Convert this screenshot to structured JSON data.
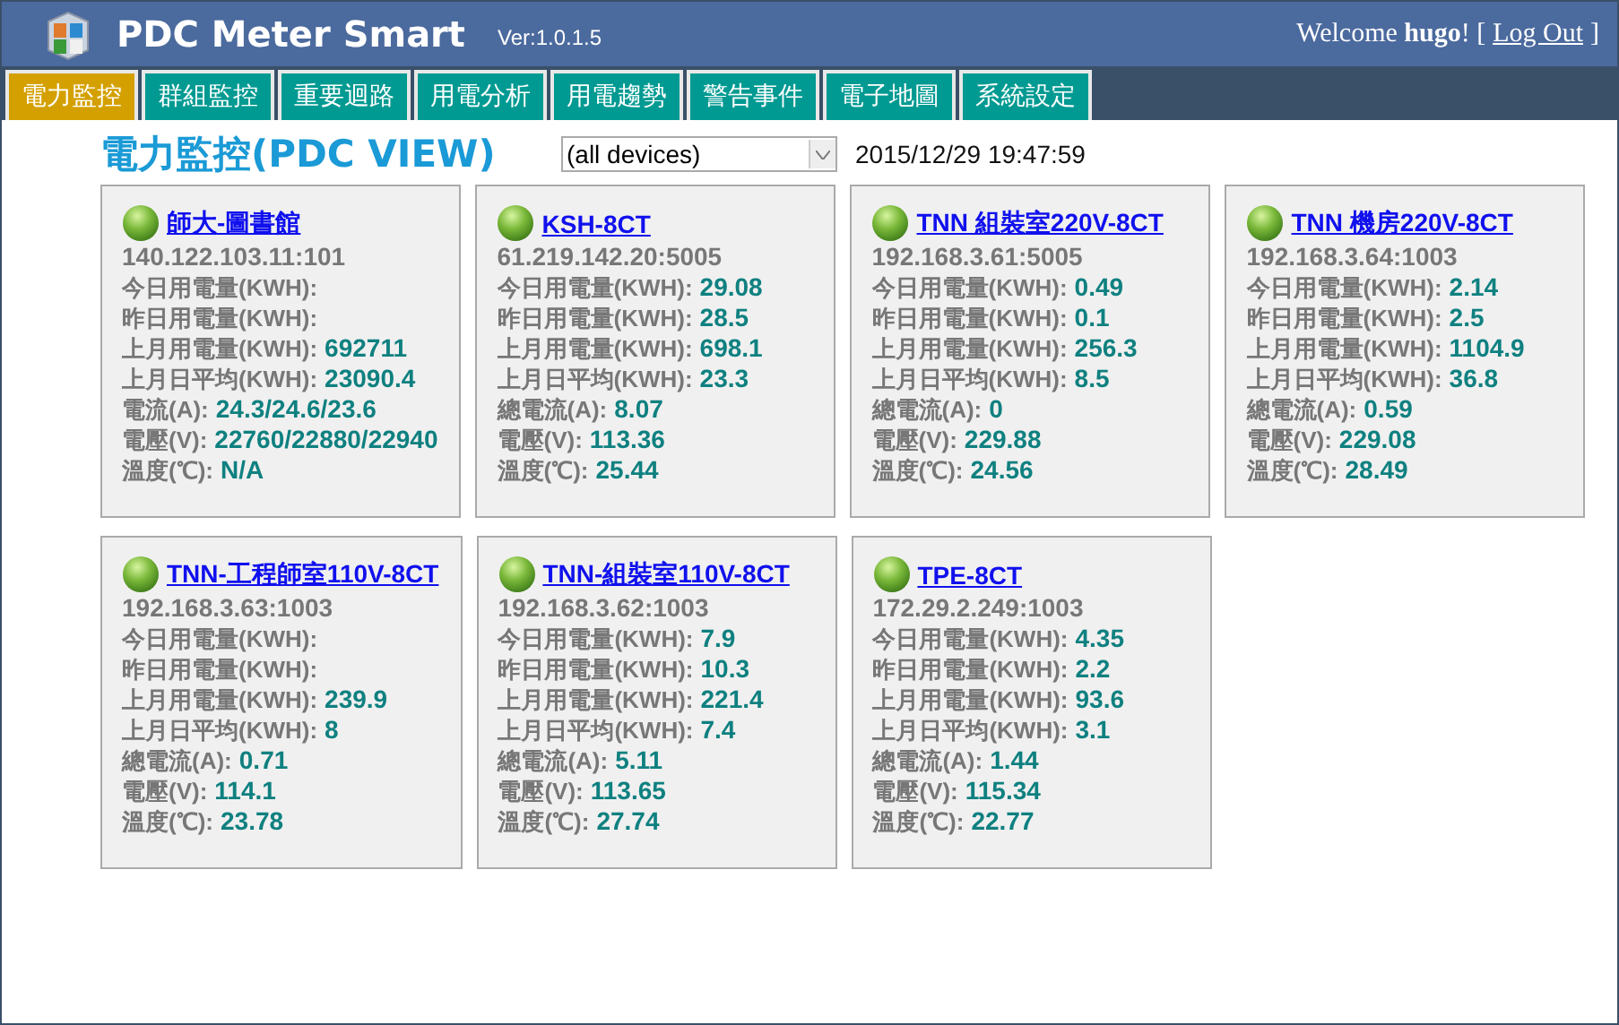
{
  "app": {
    "title": "PDC Meter Smart",
    "version": "Ver:1.0.1.5",
    "welcome": "Welcome",
    "user": "hugo",
    "welcome_end": "! [",
    "logout": "Log Out",
    "bracket_close": "]"
  },
  "tabs": [
    {
      "label": "電力監控",
      "selected": true
    },
    {
      "label": "群組監控",
      "selected": false
    },
    {
      "label": "重要迴路",
      "selected": false
    },
    {
      "label": "用電分析",
      "selected": false
    },
    {
      "label": "用電趨勢",
      "selected": false
    },
    {
      "label": "警告事件",
      "selected": false
    },
    {
      "label": "電子地圖",
      "selected": false
    },
    {
      "label": "系統設定",
      "selected": false
    }
  ],
  "page": {
    "title": "電力監控(PDC VIEW)",
    "device_filter": "(all devices)",
    "timestamp": "2015/12/29 19:47:59"
  },
  "devices": [
    {
      "name": "師大-圖書館",
      "address": "140.122.103.11:101",
      "rows": [
        {
          "label": "今日用電量(KWH):"
        },
        {
          "label": "昨日用電量(KWH):"
        },
        {
          "label": "上月用電量(KWH):",
          "value": "692711"
        },
        {
          "label": "上月日平均(KWH):",
          "value": "23090.4"
        },
        {
          "label": "電流(A):",
          "value": "24.3/24.6/23.6"
        },
        {
          "label": "電壓(V):",
          "value": "22760/22880/22940"
        },
        {
          "label": "溫度(℃):",
          "value": "N/A"
        }
      ]
    },
    {
      "name": "KSH-8CT",
      "address": "61.219.142.20:5005",
      "rows": [
        {
          "label": "今日用電量(KWH):",
          "value": "29.08"
        },
        {
          "label": "昨日用電量(KWH):",
          "value": "28.5"
        },
        {
          "label": "上月用電量(KWH):",
          "value": "698.1"
        },
        {
          "label": "上月日平均(KWH):",
          "value": "23.3"
        },
        {
          "label": "總電流(A):",
          "value": "8.07"
        },
        {
          "label": "電壓(V):",
          "value": "113.36"
        },
        {
          "label": "溫度(℃):",
          "value": "25.44"
        }
      ]
    },
    {
      "name": "TNN 組裝室220V-8CT",
      "address": "192.168.3.61:5005",
      "rows": [
        {
          "label": "今日用電量(KWH):",
          "value": "0.49"
        },
        {
          "label": "昨日用電量(KWH):",
          "value": "0.1"
        },
        {
          "label": "上月用電量(KWH):",
          "value": "256.3"
        },
        {
          "label": "上月日平均(KWH):",
          "value": "8.5"
        },
        {
          "label": "總電流(A):",
          "value": "0"
        },
        {
          "label": "電壓(V):",
          "value": "229.88"
        },
        {
          "label": "溫度(℃):",
          "value": "24.56"
        }
      ]
    },
    {
      "name": "TNN 機房220V-8CT",
      "address": "192.168.3.64:1003",
      "rows": [
        {
          "label": "今日用電量(KWH):",
          "value": "2.14"
        },
        {
          "label": "昨日用電量(KWH):",
          "value": "2.5"
        },
        {
          "label": "上月用電量(KWH):",
          "value": "1104.9"
        },
        {
          "label": "上月日平均(KWH):",
          "value": "36.8"
        },
        {
          "label": "總電流(A):",
          "value": "0.59"
        },
        {
          "label": "電壓(V):",
          "value": "229.08"
        },
        {
          "label": "溫度(℃):",
          "value": "28.49"
        }
      ]
    },
    {
      "name": "TNN-工程師室110V-8CT",
      "address": "192.168.3.63:1003",
      "rows": [
        {
          "label": "今日用電量(KWH):"
        },
        {
          "label": "昨日用電量(KWH):"
        },
        {
          "label": "上月用電量(KWH):",
          "value": "239.9"
        },
        {
          "label": "上月日平均(KWH):",
          "value": "8"
        },
        {
          "label": "總電流(A):",
          "value": "0.71"
        },
        {
          "label": "電壓(V):",
          "value": "114.1"
        },
        {
          "label": "溫度(℃):",
          "value": "23.78"
        }
      ]
    },
    {
      "name": "TNN-組裝室110V-8CT",
      "address": "192.168.3.62:1003",
      "rows": [
        {
          "label": "今日用電量(KWH):",
          "value": "7.9"
        },
        {
          "label": "昨日用電量(KWH):",
          "value": "10.3"
        },
        {
          "label": "上月用電量(KWH):",
          "value": "221.4"
        },
        {
          "label": "上月日平均(KWH):",
          "value": "7.4"
        },
        {
          "label": "總電流(A):",
          "value": "5.11"
        },
        {
          "label": "電壓(V):",
          "value": "113.65"
        },
        {
          "label": "溫度(℃):",
          "value": "27.74"
        }
      ]
    },
    {
      "name": "TPE-8CT",
      "address": "172.29.2.249:1003",
      "rows": [
        {
          "label": "今日用電量(KWH):",
          "value": "4.35"
        },
        {
          "label": "昨日用電量(KWH):",
          "value": "2.2"
        },
        {
          "label": "上月用電量(KWH):",
          "value": "93.6"
        },
        {
          "label": "上月日平均(KWH):",
          "value": "3.1"
        },
        {
          "label": "總電流(A):",
          "value": "1.44"
        },
        {
          "label": "電壓(V):",
          "value": "115.34"
        },
        {
          "label": "溫度(℃):",
          "value": "22.77"
        }
      ]
    }
  ]
}
